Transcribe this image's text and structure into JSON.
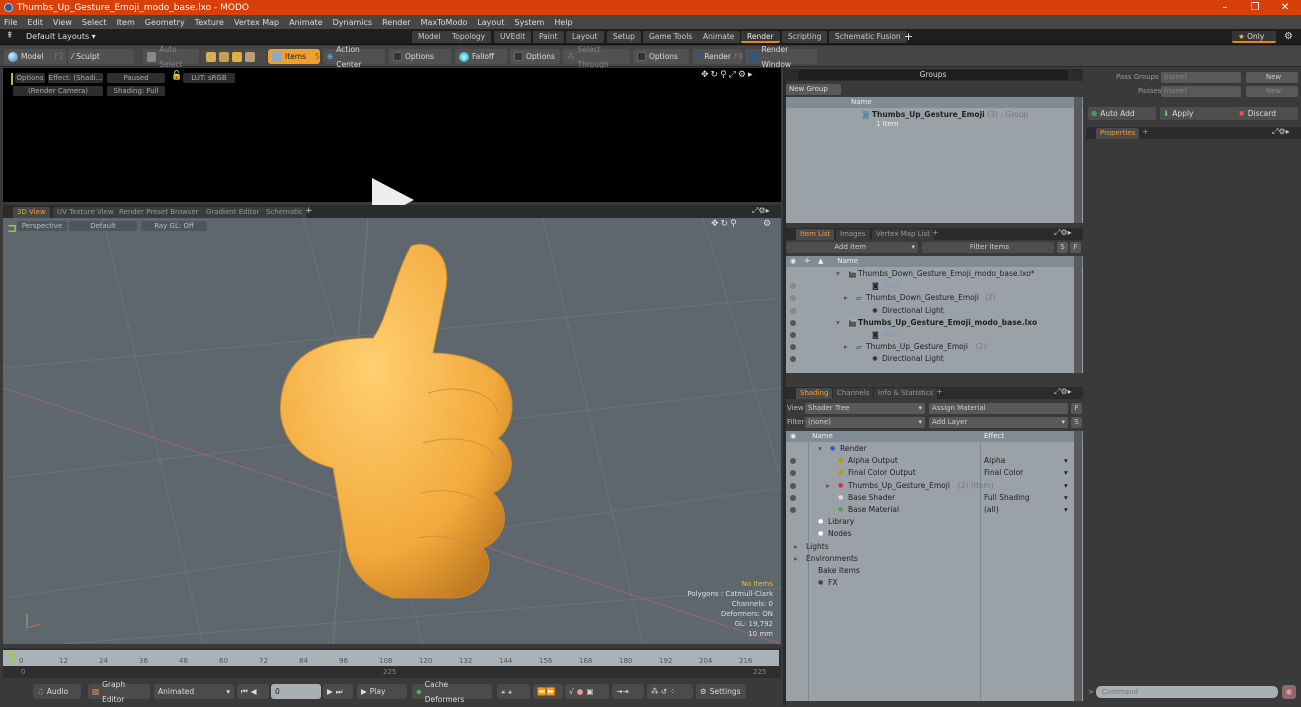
{
  "window": {
    "title": "Thumbs_Up_Gesture_Emoji_modo_base.lxo - MODO",
    "controls": [
      "minimize",
      "restore",
      "close"
    ]
  },
  "menu": [
    "File",
    "Edit",
    "View",
    "Select",
    "Item",
    "Geometry",
    "Texture",
    "Vertex Map",
    "Animate",
    "Dynamics",
    "Render",
    "MaxToModo",
    "Layout",
    "System",
    "Help"
  ],
  "layouts": {
    "default_label": "Default Layouts",
    "tabs": [
      "Model",
      "Topology",
      "UVEdit",
      "Paint",
      "Layout",
      "Setup",
      "Game Tools",
      "Animate",
      "Render",
      "Scripting",
      "Schematic Fusion"
    ],
    "active_tab": "Render",
    "add": "+",
    "only_label": "Only"
  },
  "toolbar": {
    "model": "Model",
    "model_key": "F2",
    "sculpt": "Sculpt",
    "auto_select": "Auto Select",
    "items": "Items",
    "items_key": "S",
    "action_center": "Action Center",
    "options1": "Options",
    "falloff": "Falloff",
    "options2": "Options",
    "select_through": "Select Through",
    "options3": "Options",
    "render": "Render",
    "render_key": "F9",
    "render_window": "Render Window"
  },
  "preview": {
    "options": "Options",
    "effect": "Effect: (Shadi...",
    "paused": "Paused",
    "lut": "LUT: sRGB",
    "camera": "(Render Camera)",
    "shading": "Shading: Full"
  },
  "viewport_tabs": {
    "tabs": [
      "3D View",
      "UV Texture View",
      "Render Preset Browser",
      "Gradient Editor",
      "Schematic"
    ],
    "active": "3D View",
    "add": "+"
  },
  "viewport": {
    "view": "Perspective",
    "style": "Default",
    "raygl": "Ray GL: Off",
    "stats": {
      "items": "No Items",
      "polygons": "Polygons : Catmull-Clark",
      "channels": "Channels: 0",
      "deformers": "Deformers: ON",
      "gl": "GL: 19,792",
      "unit": "10 mm"
    }
  },
  "timeline": {
    "ticks": [
      "0",
      "12",
      "24",
      "36",
      "48",
      "60",
      "72",
      "84",
      "96",
      "108",
      "120",
      "132",
      "144",
      "156",
      "168",
      "180",
      "192",
      "204",
      "216"
    ],
    "start": "0",
    "end": "225",
    "mid": "225"
  },
  "transport": {
    "audio": "Audio",
    "graph_editor": "Graph Editor",
    "animated": "Animated",
    "frame": "0",
    "play": "Play",
    "cache_deformers": "Cache Deformers",
    "settings": "Settings"
  },
  "groups": {
    "title": "Groups",
    "new_group": "New Group",
    "col_name": "Name",
    "rows": [
      {
        "name": "Thumbs_Up_Gesture_Emoji",
        "count": "(3)",
        "type": ": Group",
        "sub": "1 Item"
      }
    ]
  },
  "passes": {
    "pass_groups_label": "Pass Groups",
    "pass_groups_value": "(none)",
    "new1": "New",
    "passes_label": "Passes",
    "passes_value": "(none)",
    "new2": "New",
    "auto_add": "Auto Add",
    "apply": "Apply",
    "discard": "Discard",
    "properties_tab": "Properties",
    "add": "+"
  },
  "itemlist": {
    "tabs": [
      "Item List",
      "Images",
      "Vertex Map List"
    ],
    "active": "Item List",
    "add": "+",
    "add_item": "Add Item",
    "filter": "Filter Items",
    "s": "S",
    "f": "F",
    "col_name": "Name",
    "rows": [
      {
        "name": "Thumbs_Down_Gesture_Emoji_modo_base.lxo*",
        "bold": false,
        "dim": false
      },
      {
        "name": "Mesh",
        "bold": false,
        "dim": true
      },
      {
        "name": "Thumbs_Down_Gesture_Emoji",
        "suffix": "(2)",
        "bold": false,
        "dim": false
      },
      {
        "name": "Directional Light",
        "bold": false,
        "dim": false
      },
      {
        "name": "Thumbs_Up_Gesture_Emoji_modo_base.lxo",
        "bold": true,
        "dim": false
      },
      {
        "name": "Mesh",
        "bold": false,
        "dim": true
      },
      {
        "name": "Thumbs_Up_Gesture_Emoji",
        "suffix": "(2)",
        "bold": false,
        "dim": false
      },
      {
        "name": "Directional Light",
        "bold": false,
        "dim": false
      }
    ]
  },
  "shading": {
    "tabs": [
      "Shading",
      "Channels",
      "Info & Statistics"
    ],
    "active": "Shading",
    "add": "+",
    "view_label": "View",
    "view_value": "Shader Tree",
    "assign_material": "Assign Material",
    "f": "F",
    "filter_label": "Filter",
    "filter_value": "(none)",
    "add_layer": "Add Layer",
    "s": "S",
    "col_name": "Name",
    "col_effect": "Effect",
    "rows": [
      {
        "name": "Render",
        "effect": ""
      },
      {
        "name": "Alpha Output",
        "effect": "Alpha"
      },
      {
        "name": "Final Color Output",
        "effect": "Final Color"
      },
      {
        "name": "Thumbs_Up_Gesture_Emoji",
        "suffix": "(2) (Item)",
        "effect": ""
      },
      {
        "name": "Base Shader",
        "effect": "Full Shading"
      },
      {
        "name": "Base Material",
        "effect": "(all)"
      },
      {
        "name": "Library",
        "effect": ""
      },
      {
        "name": "Nodes",
        "effect": ""
      },
      {
        "name": "Lights",
        "effect": ""
      },
      {
        "name": "Environments",
        "effect": ""
      },
      {
        "name": "Bake Items",
        "effect": ""
      },
      {
        "name": "FX",
        "effect": ""
      }
    ]
  },
  "command": {
    "placeholder": "Command",
    "prompt": ">"
  },
  "colors": {
    "accent": "#f0a030",
    "titlebar": "#d8400a",
    "panel": "#9aa2a8",
    "viewport": "#5e676e"
  }
}
